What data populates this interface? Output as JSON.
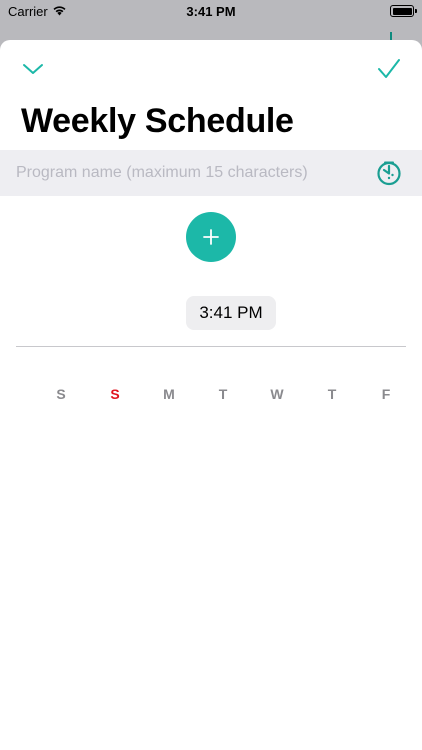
{
  "status_bar": {
    "carrier": "Carrier",
    "time": "3:41 PM",
    "icons": [
      "wifi-icon",
      "battery-icon"
    ]
  },
  "sheet": {
    "title": "Weekly Schedule",
    "dismiss_icon": "chevron-down-icon",
    "confirm_icon": "checkmark-icon",
    "accent_color": "#1cb8a8"
  },
  "program_name": {
    "value": "",
    "placeholder": "Program name (maximum 15 characters)",
    "icon": "timer-icon"
  },
  "add_button": {
    "icon": "plus-icon"
  },
  "time_picker": {
    "value": "3:41 PM"
  },
  "weekdays": [
    {
      "label": "S",
      "highlighted": false
    },
    {
      "label": "S",
      "highlighted": true,
      "color": "#e1141f"
    },
    {
      "label": "M",
      "highlighted": false
    },
    {
      "label": "T",
      "highlighted": false
    },
    {
      "label": "W",
      "highlighted": false
    },
    {
      "label": "T",
      "highlighted": false
    },
    {
      "label": "F",
      "highlighted": false
    }
  ]
}
